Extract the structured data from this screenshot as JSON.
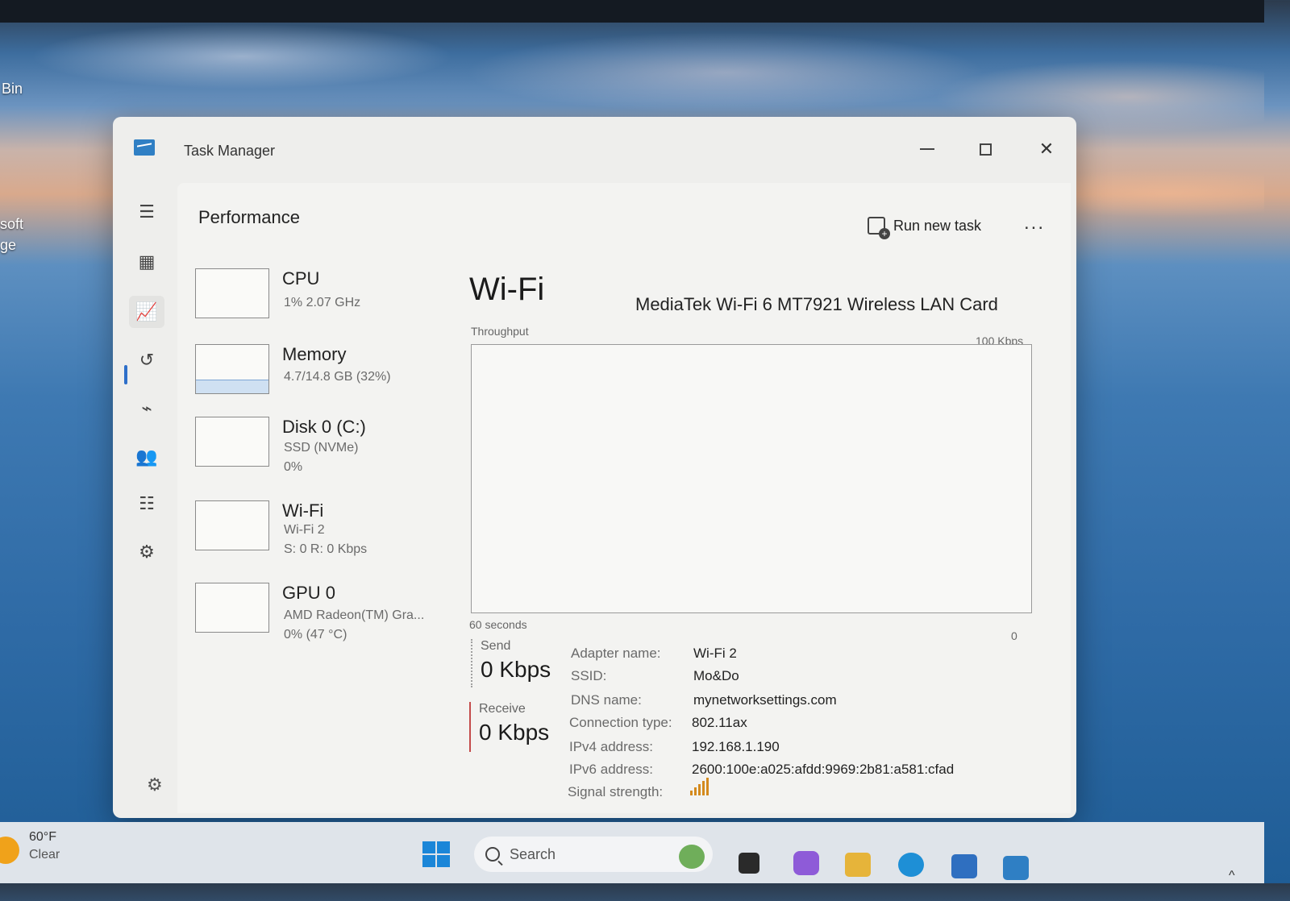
{
  "desktop": {
    "icon_labels": [
      "Bin",
      "soft",
      "ge"
    ]
  },
  "window": {
    "title": "Task Manager"
  },
  "header": {
    "page_title": "Performance",
    "run_new_task": "Run new task",
    "more": "..."
  },
  "resources": [
    {
      "name": "CPU",
      "line1": "1%  2.07 GHz",
      "line2": ""
    },
    {
      "name": "Memory",
      "line1": "4.7/14.8 GB (32%)",
      "line2": ""
    },
    {
      "name": "Disk 0 (C:)",
      "line1": "SSD (NVMe)",
      "line2": "0%"
    },
    {
      "name": "Wi-Fi",
      "line1": "Wi-Fi 2",
      "line2": "S: 0  R: 0 Kbps"
    },
    {
      "name": "GPU 0",
      "line1": "AMD Radeon(TM) Gra...",
      "line2": "0%  (47 °C)"
    }
  ],
  "detail": {
    "title": "Wi-Fi",
    "adapter": "MediaTek Wi-Fi 6 MT7921 Wireless LAN Card",
    "throughput_label": "Throughput",
    "max_label": "100 Kbps",
    "time_label": "60 seconds",
    "zero_label": "0",
    "send_label": "Send",
    "send_value": "0 Kbps",
    "receive_label": "Receive",
    "receive_value": "0 Kbps",
    "properties": [
      {
        "k": "Adapter name:",
        "v": "Wi-Fi 2"
      },
      {
        "k": "SSID:",
        "v": "Mo&Do"
      },
      {
        "k": "DNS name:",
        "v": "mynetworksettings.com"
      },
      {
        "k": "Connection type:",
        "v": "802.11ax"
      },
      {
        "k": "IPv4 address:",
        "v": "192.168.1.190"
      },
      {
        "k": "IPv6 address:",
        "v": "2600:100e:a025:afdd:9969:2b81:a581:cfad"
      },
      {
        "k": "Signal strength:",
        "v": ""
      }
    ]
  },
  "taskbar": {
    "temperature": "60°F",
    "condition": "Clear",
    "search_placeholder": "Search"
  },
  "colors": {
    "accent": "#2e6fc9",
    "receive_line": "#c44b4b",
    "signal": "#d48a1e"
  }
}
